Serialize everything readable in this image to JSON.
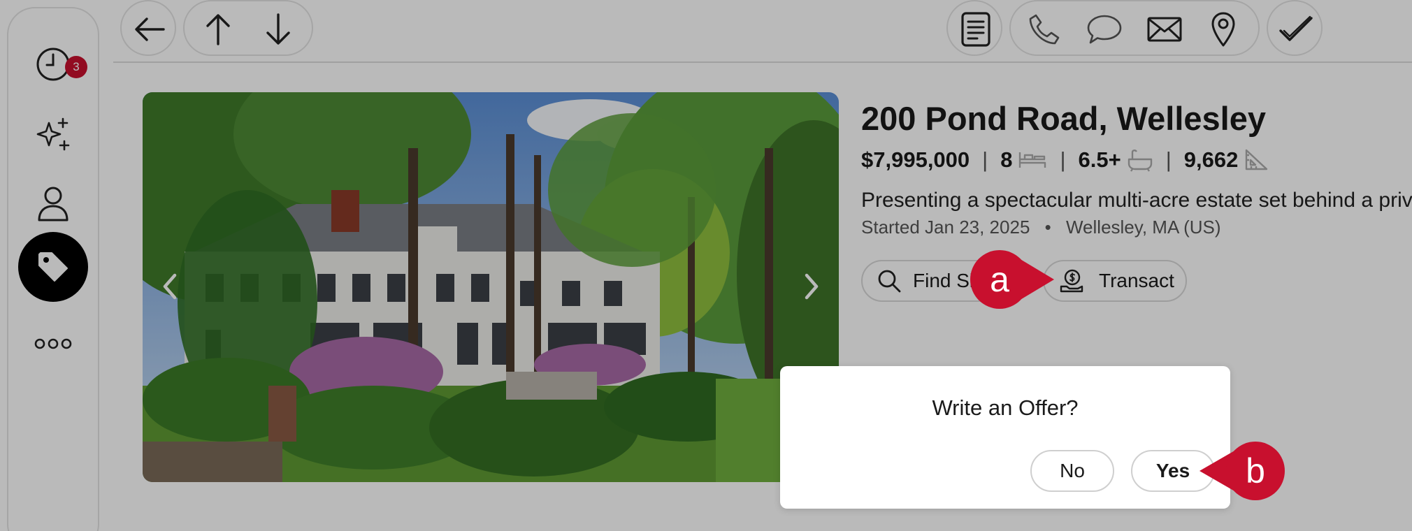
{
  "sidebar": {
    "notifications_badge": "3",
    "items": [
      {
        "name": "recent",
        "icon": "clock-icon"
      },
      {
        "name": "ai",
        "icon": "sparkles-icon"
      },
      {
        "name": "contacts",
        "icon": "person-icon"
      },
      {
        "name": "listings",
        "icon": "tag-icon",
        "active": true
      },
      {
        "name": "more",
        "icon": "more-icon"
      }
    ]
  },
  "toolbar": {
    "left": [
      "back-arrow-icon",
      "arrow-up-icon",
      "arrow-down-icon"
    ],
    "right": [
      "document-icon",
      "phone-icon",
      "chat-icon",
      "mail-icon",
      "location-pin-icon",
      "checkmark-icon"
    ]
  },
  "listing": {
    "address": "200 Pond Road, Wellesley",
    "price": "$7,995,000",
    "beds": "8",
    "baths": "6.5+",
    "sqft": "9,662",
    "description": "Presenting a spectacular multi-acre estate set behind a private gated entry",
    "started": "Started Jan 23, 2025",
    "location": "Wellesley, MA (US)",
    "meta_separator": "•",
    "actions": {
      "find_label": "Find Similar",
      "transact_label": "Transact"
    }
  },
  "dialog": {
    "question": "Write an Offer?",
    "no_label": "No",
    "yes_label": "Yes"
  },
  "callouts": {
    "a": "a",
    "b": "b"
  },
  "colors": {
    "accent": "#c8102e",
    "overlay": "rgba(0,0,0,0.27)",
    "active_nav": "#000000"
  }
}
